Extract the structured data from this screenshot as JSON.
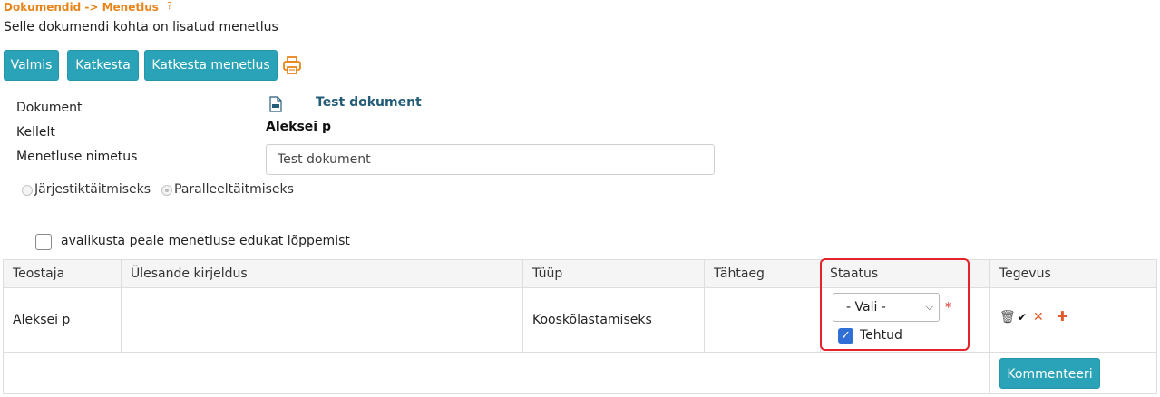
{
  "breadcrumb": {
    "text": "Dokumendid -> Menetlus",
    "help": "?"
  },
  "subtitle": "Selle dokumendi kohta on lisatud menetlus",
  "toolbar": {
    "done_label": "Valmis",
    "cancel_label": "Katkesta",
    "cancel_proceeding_label": "Katkesta menetlus",
    "print_icon": "printer-icon"
  },
  "form": {
    "document_label": "Dokument",
    "document_value": "Test dokument",
    "from_label": "Kellelt",
    "from_value": "Aleksei p",
    "name_label": "Menetluse nimetus",
    "name_value": "Test dokument"
  },
  "mode": {
    "sequential_label": "Järjestiktäitmiseks",
    "parallel_label": "Paralleeltäitmiseks",
    "selected": "Paralleeltäitmiseks"
  },
  "publish": {
    "label": "avalikusta peale menetluse edukat lõppemist",
    "checked": false
  },
  "table": {
    "headers": [
      "Teostaja",
      "Ülesande kirjeldus",
      "Tüüp",
      "Tähtaeg",
      "Staatus",
      "Tegevus"
    ],
    "rows": [
      {
        "executor": "Aleksei p",
        "description": "",
        "type": "Kooskõlastamiseks",
        "deadline": "",
        "status_select": "- Vali -",
        "required_mark": "*",
        "done_label": "Tehtud",
        "done_checked": true
      }
    ],
    "comment_label": "Kommenteeri"
  },
  "colors": {
    "accent": "#2aa3b8",
    "breadcrumb": "#e8841a",
    "link": "#245c78",
    "highlight": "#e4232b",
    "checkbox": "#2f6fd6"
  }
}
